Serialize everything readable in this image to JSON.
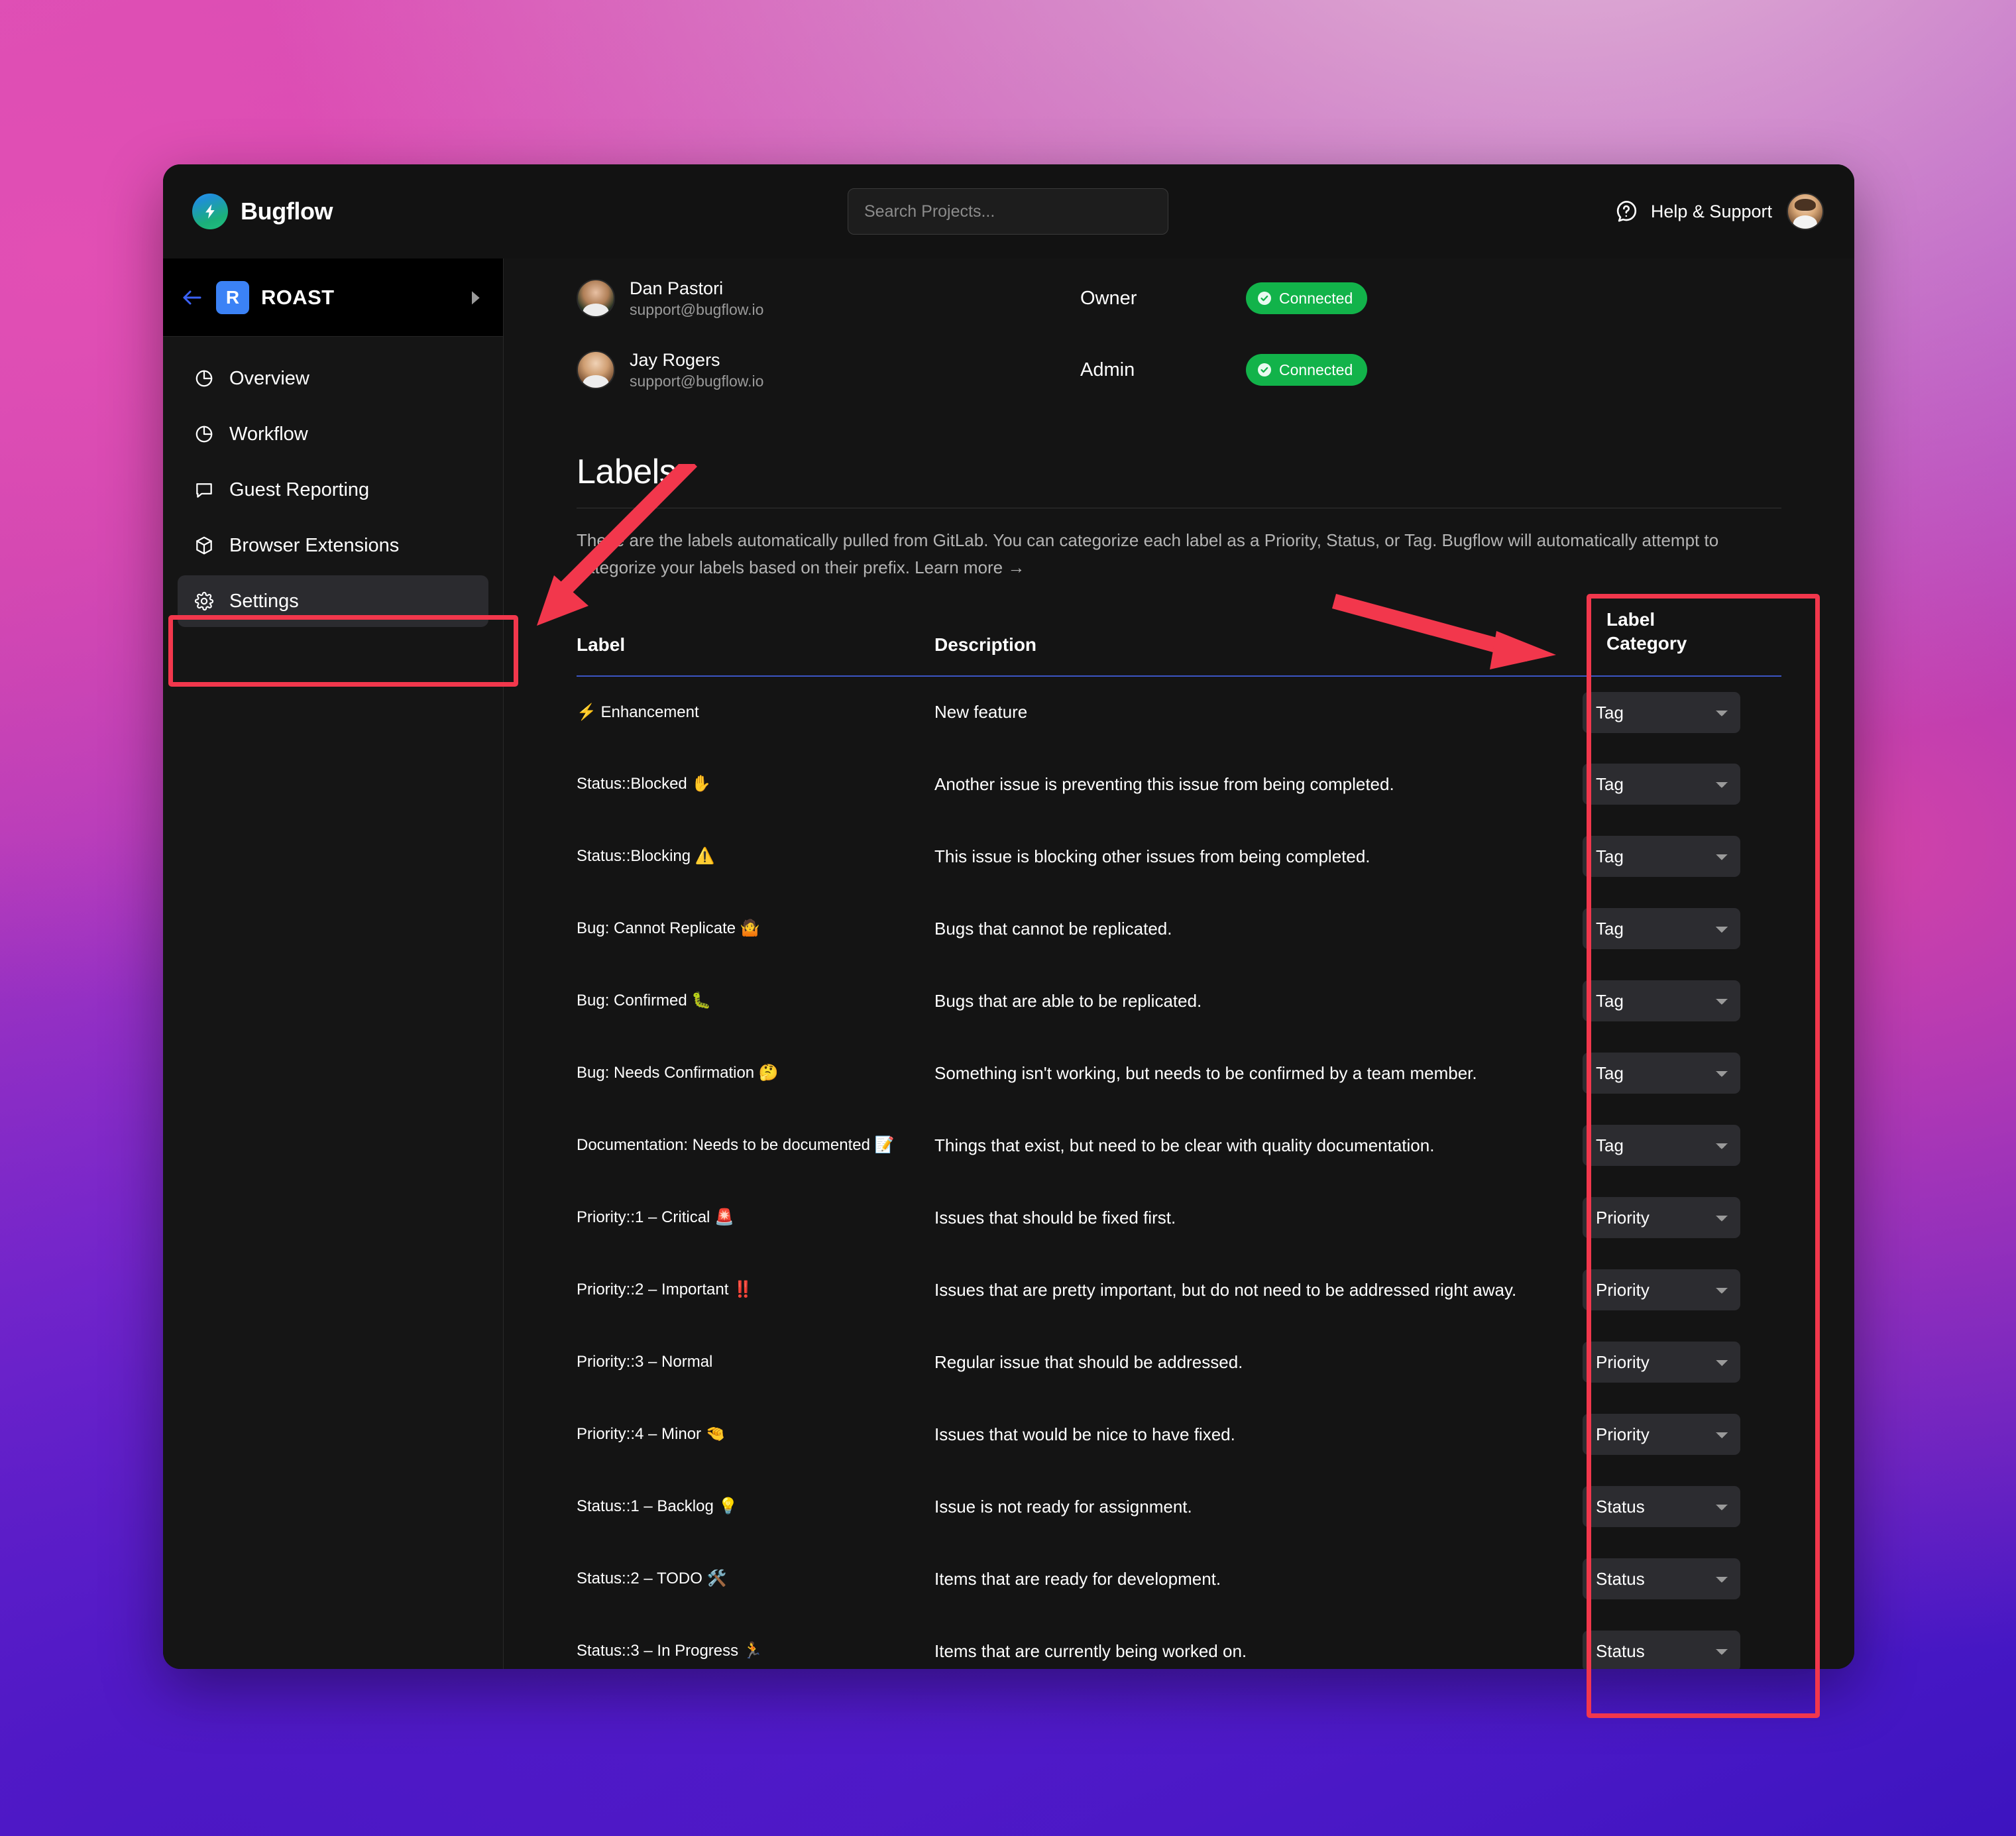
{
  "brand": {
    "name": "Bugflow",
    "logo_icon": "lightning-bolt-icon"
  },
  "search": {
    "placeholder": "Search Projects...",
    "value": ""
  },
  "topbar": {
    "help_label": "Help & Support",
    "help_icon": "question-bubble-icon",
    "avatar": "user-avatar"
  },
  "sidebar": {
    "project": {
      "badge": "R",
      "name": "ROAST",
      "back_icon": "arrow-left-icon",
      "caret_icon": "chevron-right-icon"
    },
    "items": [
      {
        "label": "Overview",
        "icon": "pie-chart-icon",
        "active": false
      },
      {
        "label": "Workflow",
        "icon": "pie-chart-icon",
        "active": false
      },
      {
        "label": "Guest Reporting",
        "icon": "chat-bubble-icon",
        "active": false
      },
      {
        "label": "Browser Extensions",
        "icon": "package-icon",
        "active": false
      },
      {
        "label": "Settings",
        "icon": "gear-icon",
        "active": true
      }
    ]
  },
  "members": [
    {
      "name": "Dan Pastori",
      "email": "support@bugflow.io",
      "role": "Owner",
      "status": "Connected",
      "status_color": "#12b34a"
    },
    {
      "name": "Jay Rogers",
      "email": "support@bugflow.io",
      "role": "Admin",
      "status": "Connected",
      "status_color": "#12b34a"
    }
  ],
  "labels_section": {
    "title": "Labels",
    "description": "These are the labels automatically pulled from GitLab. You can categorize each label as a Priority, Status, or Tag. Bugflow will automatically attempt to categorize your labels based on their prefix. Learn more →",
    "columns": {
      "label": "Label",
      "description": "Description",
      "category_line1": "Label",
      "category_line2": "Category"
    },
    "category_options": [
      "Tag",
      "Priority",
      "Status"
    ],
    "rows": [
      {
        "label": "⚡ Enhancement",
        "description": "New feature",
        "category": "Tag"
      },
      {
        "label": "Status::Blocked ✋",
        "description": "Another issue is preventing this issue from being completed.",
        "category": "Tag"
      },
      {
        "label": "Status::Blocking ⚠️",
        "description": "This issue is blocking other issues from being completed.",
        "category": "Tag"
      },
      {
        "label": "Bug: Cannot Replicate 🤷",
        "description": "Bugs that cannot be replicated.",
        "category": "Tag"
      },
      {
        "label": "Bug: Confirmed 🐛",
        "description": "Bugs that are able to be replicated.",
        "category": "Tag"
      },
      {
        "label": "Bug: Needs Confirmation 🤔",
        "description": "Something isn't working, but needs to be confirmed by a team member.",
        "category": "Tag"
      },
      {
        "label": "Documentation: Needs to be documented 📝",
        "description": "Things that exist, but need to be clear with quality documentation.",
        "category": "Tag"
      },
      {
        "label": "Priority::1 – Critical 🚨",
        "description": "Issues that should be fixed first.",
        "category": "Priority"
      },
      {
        "label": "Priority::2 – Important ‼️",
        "description": "Issues that are pretty important, but do not need to be addressed right away.",
        "category": "Priority"
      },
      {
        "label": "Priority::3 – Normal",
        "description": "Regular issue that should be addressed.",
        "category": "Priority"
      },
      {
        "label": "Priority::4 – Minor 🤏",
        "description": "Issues that would be nice to have fixed.",
        "category": "Priority"
      },
      {
        "label": "Status::1 – Backlog 💡",
        "description": "Issue is not ready for assignment.",
        "category": "Status"
      },
      {
        "label": "Status::2 – TODO 🛠️",
        "description": "Items that are ready for development.",
        "category": "Status"
      },
      {
        "label": "Status::3 – In Progress 🏃",
        "description": "Items that are currently being worked on.",
        "category": "Status"
      }
    ]
  },
  "annotations": {
    "highlight_color": "#f2374c",
    "boxes": [
      {
        "name": "settings-sidebar-item"
      },
      {
        "name": "label-category-column"
      }
    ],
    "arrows": [
      {
        "name": "arrow-to-settings"
      },
      {
        "name": "arrow-to-label-category"
      }
    ]
  },
  "colors": {
    "accent_blue": "#3b55c4",
    "project_badge": "#3b82f6",
    "window_bg": "#141414"
  }
}
